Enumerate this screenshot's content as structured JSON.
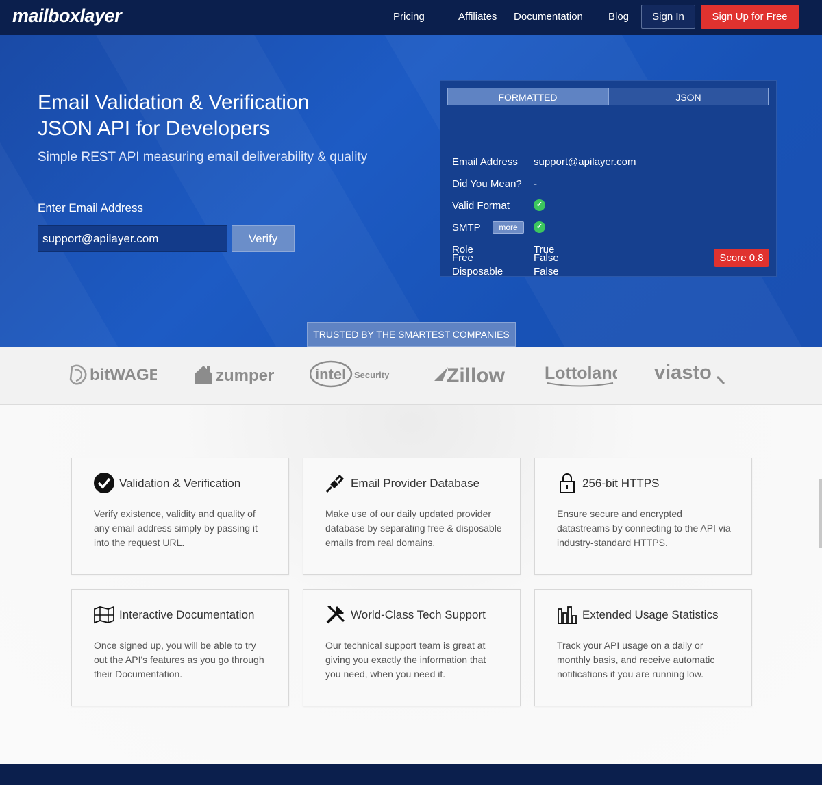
{
  "nav": {
    "logo": "mailboxlayer",
    "links": [
      "Pricing",
      "Affiliates",
      "Documentation",
      "Blog"
    ],
    "signin": "Sign In",
    "signup": "Sign Up for Free"
  },
  "hero": {
    "title_line1": "Email Validation & Verification",
    "title_line2": "JSON API for Developers",
    "subtitle": "Simple REST API measuring email deliverability & quality",
    "email_label": "Enter Email Address",
    "email_value": "support@apilayer.com",
    "verify": "Verify"
  },
  "result_panel": {
    "tabs": [
      "FORMATTED",
      "JSON"
    ],
    "rows": [
      {
        "label": "Email Address",
        "value": "support@apilayer.com"
      },
      {
        "label": "Did You Mean?",
        "value": "-"
      },
      {
        "label": "Valid Format",
        "value": ""
      },
      {
        "label": "SMTP",
        "value": ""
      },
      {
        "label": "Role",
        "value": "True"
      },
      {
        "label": "Disposable",
        "value": "False"
      },
      {
        "label": "Free",
        "value": "False"
      }
    ],
    "more": "more",
    "score": "Score 0.8",
    "check_color": "#3cc65e"
  },
  "trusted": "TRUSTED BY THE SMARTEST COMPANIES",
  "companies": [
    "bitWAGE",
    "zumper",
    "intel",
    "Security",
    "Zillow",
    "Lottoland",
    "viasto"
  ],
  "features": [
    {
      "icon": "check-circle-icon",
      "title": "Validation & Verification",
      "text": "Verify existence, validity and quality of any email address simply by passing it into the request URL."
    },
    {
      "icon": "plug-icon",
      "title": "Email Provider Database",
      "text": "Make use of our daily updated provider database by separating free & disposable emails from real domains."
    },
    {
      "icon": "lock-icon",
      "title": "256-bit HTTPS",
      "text": "Ensure secure and encrypted datastreams by connecting to the API via industry-standard HTTPS."
    },
    {
      "icon": "map-icon",
      "title": "Interactive Documentation",
      "text": "Once signed up, you will be able to try out the API's features as you go through their Documentation."
    },
    {
      "icon": "tools-icon",
      "title": "World-Class Tech Support",
      "text": "Our technical support team is great at giving you exactly the information that you need, when you need it."
    },
    {
      "icon": "bar-chart-icon",
      "title": "Extended Usage Statistics",
      "text": "Track your API usage on a daily or monthly basis, and receive automatic notifications if you are running low."
    }
  ],
  "colors": {
    "nav": "#0b1f4d",
    "hero": "#1d5bc4",
    "accent_red": "#e0322f"
  }
}
